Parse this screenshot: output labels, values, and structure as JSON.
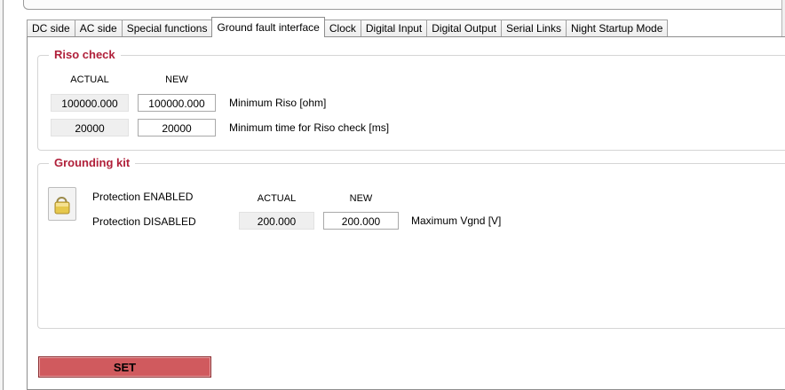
{
  "tabs": [
    {
      "label": "DC side",
      "active": false
    },
    {
      "label": "AC side",
      "active": false
    },
    {
      "label": "Special functions",
      "active": false
    },
    {
      "label": "Ground fault interface",
      "active": true
    },
    {
      "label": "Clock",
      "active": false
    },
    {
      "label": "Digital Input",
      "active": false
    },
    {
      "label": "Digital Output",
      "active": false
    },
    {
      "label": "Serial Links",
      "active": false
    },
    {
      "label": "Night Startup Mode",
      "active": false
    }
  ],
  "riso": {
    "title": "Riso check",
    "col_actual": "ACTUAL",
    "col_new": "NEW",
    "rows": [
      {
        "actual": "100000.000",
        "new": "100000.000",
        "label": "Minimum Riso [ohm]"
      },
      {
        "actual": "20000",
        "new": "20000",
        "label": "Minimum time for Riso check [ms]"
      }
    ]
  },
  "grounding": {
    "title": "Grounding kit",
    "icon": "lock-icon",
    "protection_enabled": "Protection ENABLED",
    "protection_disabled": "Protection DISABLED",
    "col_actual": "ACTUAL",
    "col_new": "NEW",
    "actual": "200.000",
    "new": "200.000",
    "label": "Maximum Vgnd [V]"
  },
  "set_button": "SET",
  "colors": {
    "accent_title": "#b0203a",
    "set_button": "#d05a5e"
  }
}
